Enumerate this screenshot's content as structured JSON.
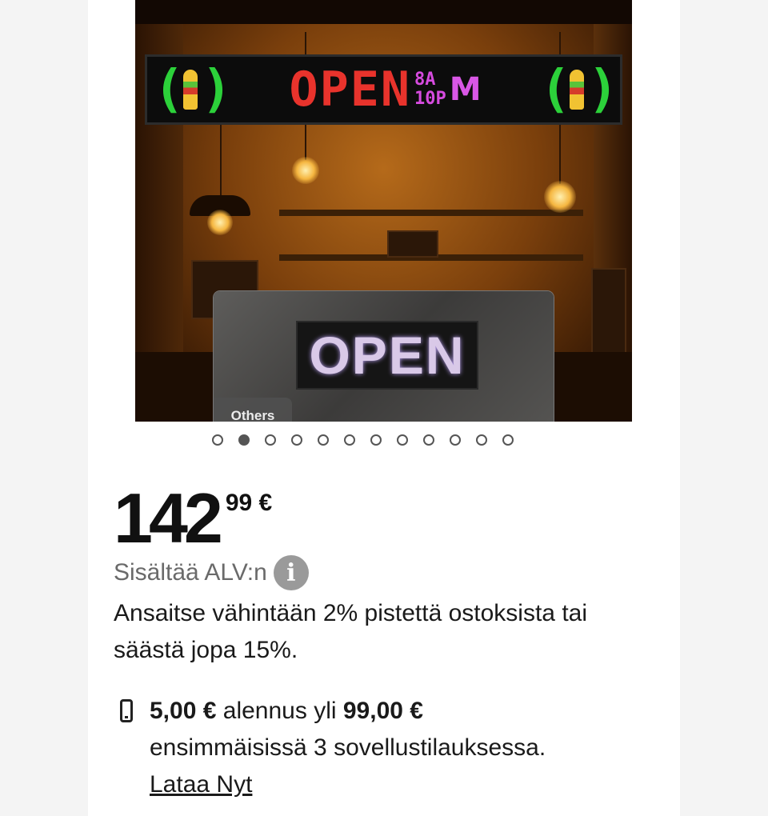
{
  "hero": {
    "led_sign_text": "OPEN",
    "led_sign_time_top": "8A",
    "led_sign_time_bottom": "10P",
    "led_sign_time_suffix": "M",
    "inset_sign_text": "OPEN",
    "inset_tag": "Others"
  },
  "carousel": {
    "total": 12,
    "active_index": 1
  },
  "price": {
    "integer": "142",
    "decimal": "99 €"
  },
  "vat": {
    "label": "Sisältää ALV:n",
    "info_symbol": "i"
  },
  "points": {
    "text": "Ansaitse vähintään 2% pistettä ostoksista tai säästä jopa 15%."
  },
  "promo": {
    "icon": "phone-icon",
    "discount": "5,00 €",
    "middle": "alennus yli",
    "threshold": "99,00 €",
    "line2": "ensimmäisissä 3 sovellustilauksessa.",
    "link": "Lataa Nyt"
  },
  "colors": {
    "led_green": "#2cd13a",
    "led_red": "#e8332c",
    "led_pink": "#d64bdf",
    "dot_active": "#555555"
  }
}
